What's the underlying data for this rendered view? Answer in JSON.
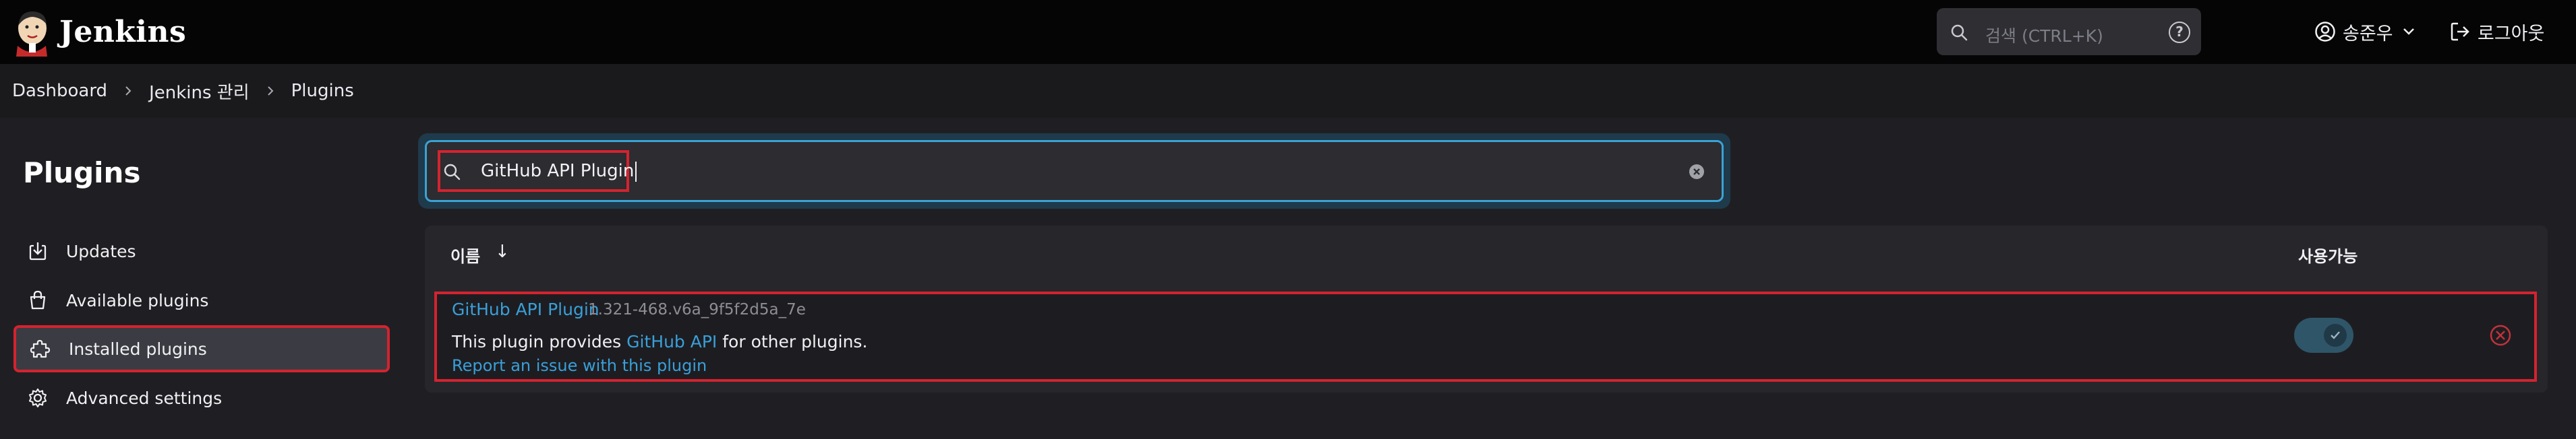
{
  "header": {
    "brand": "Jenkins",
    "search_placeholder": "검색 (CTRL+K)",
    "help": "?",
    "user": "송준우",
    "logout": "로그아웃"
  },
  "breadcrumb": [
    "Dashboard",
    "Jenkins 관리",
    "Plugins"
  ],
  "sidebar": {
    "title": "Plugins",
    "items": [
      {
        "label": "Updates",
        "icon": "download-icon"
      },
      {
        "label": "Available plugins",
        "icon": "shopping-bag-icon"
      },
      {
        "label": "Installed plugins",
        "icon": "puzzle-icon",
        "active": true
      },
      {
        "label": "Advanced settings",
        "icon": "gear-icon"
      }
    ]
  },
  "filter": {
    "value": "GitHub API Plugin"
  },
  "table": {
    "col_name": "이름",
    "sort_arrow": "↓",
    "col_enabled": "사용가능",
    "rows": [
      {
        "name": "GitHub API Plugin",
        "version": "1.321-468.v6a_9f5f2d5a_7e",
        "desc_prefix": "This plugin provides ",
        "desc_link": "GitHub API",
        "desc_suffix": " for other plugins.",
        "issue": "Report an issue with this plugin",
        "enabled": true
      }
    ]
  },
  "colors": {
    "accent": "#3a9fd9",
    "highlight": "#d4232f",
    "header_bg": "#050506",
    "page_bg": "#1f1f23"
  }
}
